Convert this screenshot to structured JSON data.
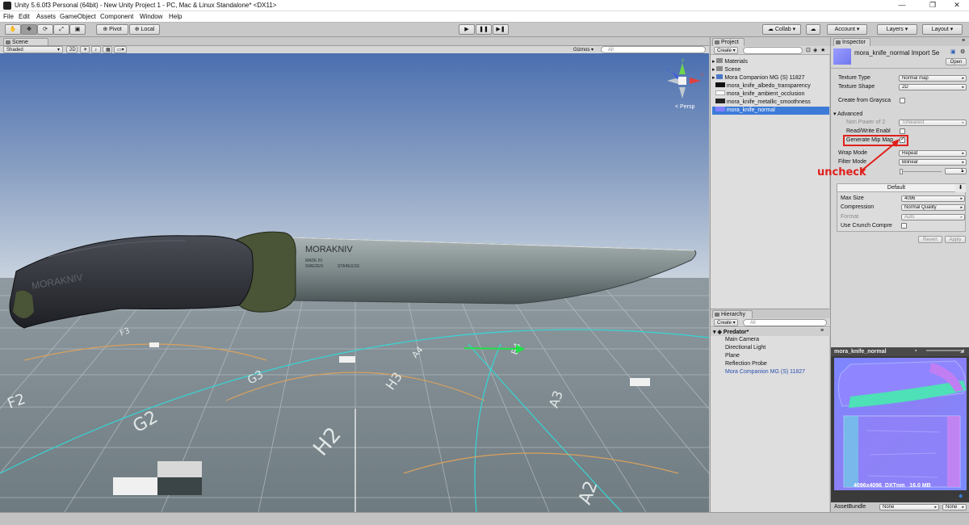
{
  "window": {
    "title": "Unity 5.6.0f3 Personal (64bit) - New Unity Project 1 - PC, Mac & Linux Standalone* <DX11>",
    "controls": {
      "minimize": "—",
      "maximize": "❐",
      "close": "✕"
    }
  },
  "menu": [
    "File",
    "Edit",
    "Assets",
    "GameObject",
    "Component",
    "Window",
    "Help"
  ],
  "toolbar": {
    "tools": [
      "hand-icon",
      "move-icon",
      "rotate-icon",
      "scale-icon",
      "rect-icon"
    ],
    "pivot": "Pivot",
    "local": "Local",
    "collab": "Collab ▾",
    "account": "Account",
    "layers": "Layers",
    "layout": "Layout"
  },
  "scene": {
    "tab": "Scene",
    "shading": "Shaded",
    "mode2d": "2D",
    "gizmos": "Gizmos ▾",
    "search_placeholder": "All",
    "persp": "Persp",
    "gizmo_axes": {
      "y": "y",
      "x": "x",
      "z": "z"
    },
    "knife_brand_text": "MORAKNIV",
    "handle_text": "MORAKNIV",
    "blade_small_text": [
      "MADE IN",
      "SWEDEN",
      "STAINLESS"
    ],
    "grid_labels": [
      "F2",
      "G2",
      "H2",
      "A2",
      "G3",
      "H3",
      "A3",
      "A4",
      "B4",
      "F3"
    ]
  },
  "project": {
    "tab": "Project",
    "create": "Create ▾",
    "search_placeholder": "",
    "items": [
      {
        "name": "Materials",
        "kind": "folder"
      },
      {
        "name": "Scene",
        "kind": "folder"
      },
      {
        "name": "Mora Companion MG (S) 11827",
        "kind": "model"
      },
      {
        "name": "mora_knife_albedo_transparency",
        "kind": "texture"
      },
      {
        "name": "mora_knife_ambient_occlusion",
        "kind": "texture"
      },
      {
        "name": "mora_knife_metallic_smoothness",
        "kind": "texture"
      },
      {
        "name": "mora_knife_normal",
        "kind": "texture",
        "selected": true
      }
    ]
  },
  "hierarchy": {
    "tab": "Hierarchy",
    "create": "Create ▾",
    "search_placeholder": "All",
    "root": "Predator*",
    "items": [
      "Main Camera",
      "Directional Light",
      "Plane",
      "Reflection Probe",
      "Mora Companion MG (S) 11827"
    ]
  },
  "inspector": {
    "tab": "Inspector",
    "title": "mora_knife_normal Import Se",
    "open": "Open",
    "texture_type_label": "Texture Type",
    "texture_type_value": "Normal map",
    "texture_shape_label": "Texture Shape",
    "texture_shape_value": "2D",
    "create_from_grayscale": "Create from Graysca",
    "advanced": "Advanced",
    "non_power_label": "Non Power of 2",
    "non_power_value": "ToNearest",
    "read_write": "Read/Write Enabl",
    "generate_mipmap": "Generate Mip Map",
    "wrap_mode_label": "Wrap Mode",
    "wrap_mode_value": "Repeat",
    "filter_mode_label": "Filter Mode",
    "filter_mode_value": "Bilinear",
    "aniso_value": "1",
    "annotation": "uncheck",
    "platform_tab": "Default",
    "max_size_label": "Max Size",
    "max_size_value": "4096",
    "compression_label": "Compression",
    "compression_value": "Normal Quality",
    "format_label": "Format",
    "format_value": "Auto",
    "crunch": "Use Crunch Compre",
    "revert": "Revert",
    "apply": "Apply"
  },
  "preview": {
    "title": "mora_knife_normal",
    "info": "4096x4096  DXTnm   16.0 MB",
    "assetbundle_label": "AssetBundle",
    "assetbundle_value": "None",
    "assetbundle_variant": "None"
  },
  "colors": {
    "selection": "#3d7bd9",
    "annotation": "#e0201c",
    "sky_top": "#4a6fb0",
    "normal_map": "#8080ff"
  }
}
